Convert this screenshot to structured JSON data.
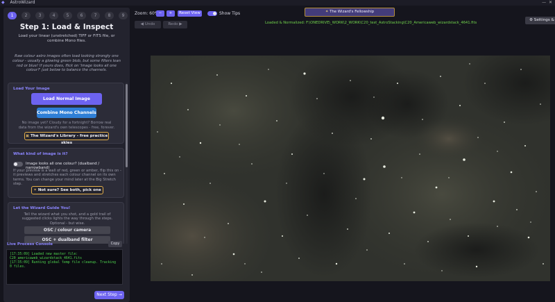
{
  "window": {
    "title": "AstroWizard"
  },
  "steps": [
    "1",
    "2",
    "3",
    "4",
    "5",
    "6",
    "7",
    "8",
    "9"
  ],
  "step_panel": {
    "title": "Step 1: Load & Inspect",
    "description": "Load your linear (unstretched) TIFF or FITS file, or combine Mono files.",
    "hint": "Raw colour astro images often load looking strongly one colour - usually a glowing green blob, but some filters lean red or blue! If yours does, flick on 'Image looks all one colour?' just below to balance the channels."
  },
  "load_card": {
    "title": "Load Your Image",
    "load_button": "Load Normal Image (RGB/OSC)",
    "combine_button": "Combine Mono Channels",
    "no_image_text": "No image yet? Cloudy for a fortnight? Borrow real data from the wizard's own telescopes - free, forever.",
    "library_button": "The Wizard's Library - free practice skies"
  },
  "kind_card": {
    "title": "What kind of image is it?",
    "toggle_label": "Image looks all one colour? (dualband / narrowband)",
    "toggle_desc": "If your preview is a wall of red, green or amber, flip this on - it previews and stretches each colour channel on its own terms. You can change your mind later at the Big Stretch step.",
    "not_sure_button": "Not sure? See both, pick one"
  },
  "guide_card": {
    "title": "Let the Wizard Guide You!",
    "desc": "Tell the wizard what you shot, and a gold trail of suggested clicks lights the way through the steps. Optional - but wise.",
    "options": [
      "OSC / colour camera",
      "OSC + dualband filter"
    ]
  },
  "console": {
    "title": "Live Process Console",
    "copy_label": "Copy",
    "lines": [
      "[17:35:09] Loaded new master file: C20_americaweb_wizardstack_4641.fits",
      "[17:35:09] Running global temp file cleanup. Tracking 0 files."
    ]
  },
  "next_button": "Next Step →",
  "toolbar": {
    "zoom_label": "Zoom: 60%",
    "zoom_out": "−",
    "zoom_in": "+",
    "reset_view": "Reset View",
    "show_tips": "Show Tips",
    "undo": "◀ Undo",
    "redo": "Redo ▶"
  },
  "fellowship_button": "The Wizard's Fellowship",
  "loaded_path": "Loaded & Normalized: F:\\ONEDRIVE\\_WORK\\2_WORK\\C20_test_AstroStacking\\C20_Americaweb_wizardstack_4641.fits",
  "settings_label": "⚙ Settings & Help",
  "colors": {
    "accent": "#6d63f0",
    "blue": "#2f7fd6",
    "console_green": "#4ed44e",
    "path_green": "#72d44c",
    "gold": "#e5b04a"
  }
}
